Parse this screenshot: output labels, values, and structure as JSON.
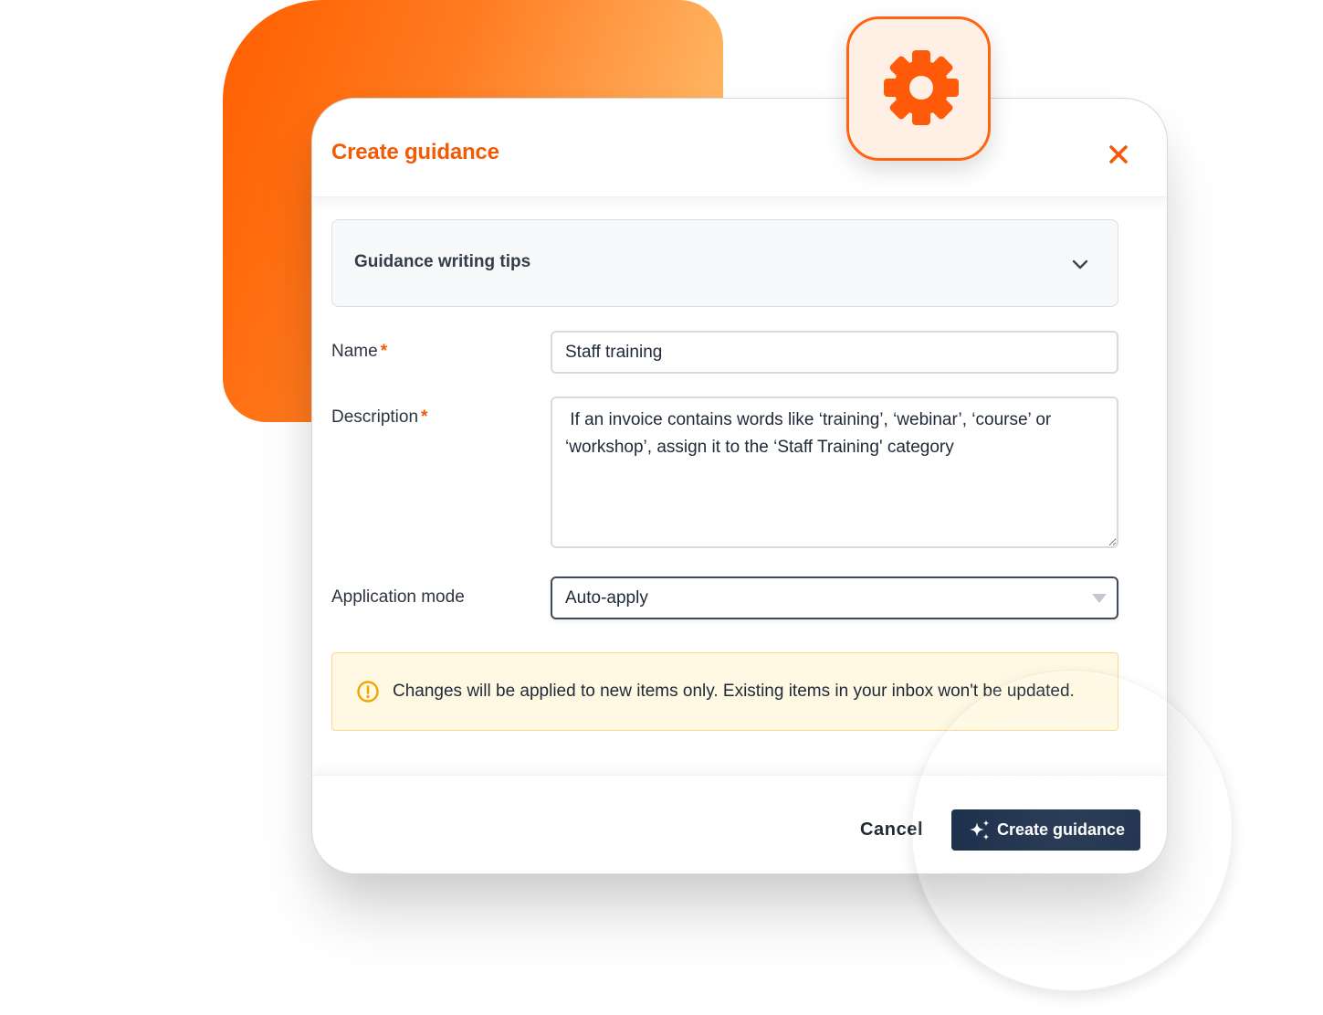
{
  "dialog": {
    "title": "Create guidance",
    "close_icon": "close-icon"
  },
  "tips": {
    "label": "Guidance writing tips",
    "icon": "chevron-down-icon"
  },
  "form": {
    "name": {
      "label": "Name",
      "required_mark": "*",
      "value": "Staff training"
    },
    "description": {
      "label": "Description",
      "required_mark": "*",
      "value": " If an invoice contains words like ‘training’, ‘webinar’, ‘course’ or ‘workshop’, assign it to the ‘Staff Training' category"
    },
    "application_mode": {
      "label": "Application mode",
      "value": "Auto-apply"
    }
  },
  "alert": {
    "icon": "warning-icon",
    "text": "Changes will be applied to new items only. Existing items in your inbox won't be updated."
  },
  "footer": {
    "cancel_label": "Cancel",
    "create_label": "Create guidance",
    "create_icon": "sparkle-icon"
  },
  "badge": {
    "icon": "gear-icon"
  },
  "colors": {
    "accent": "#f25a06",
    "primary_button": "#0f2340",
    "alert_bg": "#fff8e2",
    "alert_border": "#fbd98a",
    "alert_icon": "#f0a500"
  }
}
